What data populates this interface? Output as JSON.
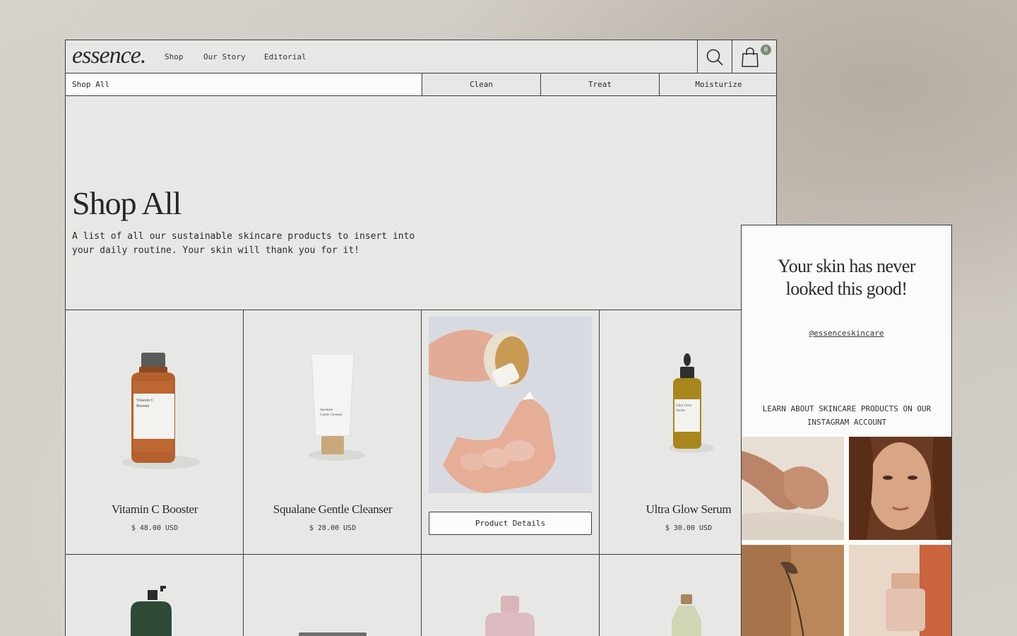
{
  "brand": {
    "logo": "essence."
  },
  "nav": {
    "links": [
      "Shop",
      "Our Story",
      "Editorial"
    ],
    "cart_count": "0"
  },
  "subnav": {
    "active": "Shop All",
    "categories": [
      "Clean",
      "Treat",
      "Moisturize"
    ]
  },
  "hero": {
    "title": "Shop All",
    "description": "A list of all our sustainable skincare products to insert into your daily routine. Your skin will thank you for it!"
  },
  "products": [
    {
      "name": "Vitamin C Booster",
      "price": "$ 48.00 USD",
      "label_lines": [
        "Vitamin C",
        "Booster"
      ]
    },
    {
      "name": "Squalane Gentle Cleanser",
      "price": "$ 28.00 USD",
      "label_lines": [
        "Squalane",
        "Gentle Cleanser"
      ]
    },
    {
      "button": "Product Details"
    },
    {
      "name": "Ultra Glow Serum",
      "price": "$ 30.00 USD",
      "label_lines": [
        "Ultra Glow",
        "Serum"
      ]
    }
  ],
  "instagram": {
    "title_line1": "Your skin has never",
    "title_line2": "looked this good!",
    "handle": "@essenceskincare",
    "cta": "LEARN ABOUT SKINCARE PRODUCTS ON OUR INSTAGRAM ACCOUNT"
  },
  "colors": {
    "page_bg": "#e7e8e5",
    "panel_bg": "#fbfbf9",
    "border": "#3a3a3a",
    "badge": "#7b8a78"
  },
  "icons": [
    "search-icon",
    "cart-icon"
  ]
}
